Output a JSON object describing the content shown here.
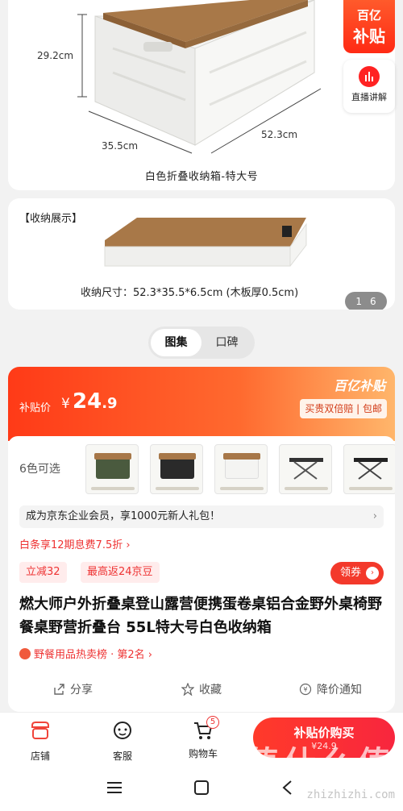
{
  "gallery": {
    "dim_height": "29.2cm",
    "dim_width": "35.5cm",
    "dim_length": "52.3cm",
    "caption": "白色折叠收纳箱-特大号",
    "subsidy_badge_line1": "百亿",
    "subsidy_badge_line2": "补贴",
    "live_label": "直播讲解",
    "storage_tag": "【收纳展示】",
    "storage_size": "收纳尺寸：52.3*35.5*6.5cm (木板厚0.5cm)",
    "pager_current": "1",
    "pager_total": "6"
  },
  "tabs": [
    {
      "label": "图集",
      "active": true
    },
    {
      "label": "口碑",
      "active": false
    }
  ],
  "price": {
    "label": "补贴价",
    "currency": "¥",
    "integer": "24",
    "decimal": ".9",
    "badge": "百亿补贴",
    "guarantee": "买贵双倍赔 | 包邮"
  },
  "variants": {
    "label": "6色可选",
    "thumbs": [
      "green-box",
      "dark-box",
      "white-box",
      "table",
      "table"
    ]
  },
  "member_text": "成为京东企业会员，享1000元新人礼包！",
  "installment_text": "白条享12期息费7.5折 ›",
  "coupons": [
    "立减32",
    "最高返24京豆"
  ],
  "claim_label": "领券",
  "product_title": "燃大师户外折叠桌登山露营便携蛋卷桌铝合金野外桌椅野餐桌野营折叠台 55L特大号白色收纳箱",
  "rank_text": "野餐用品热卖榜 · 第2名 ›",
  "actions": {
    "share": "分享",
    "favorite": "收藏",
    "price_alert": "降价通知"
  },
  "bottom_bar": {
    "store": "店铺",
    "service": "客服",
    "cart": "购物车",
    "cart_count": "5",
    "buy_label": "补贴价购买",
    "buy_price": "¥24.9"
  },
  "watermark": "值什么值",
  "watermark_url": "zhizhizhi.com",
  "colors": {
    "accent": "#ff3a17",
    "wood": "#a77748",
    "red": "#e33"
  }
}
